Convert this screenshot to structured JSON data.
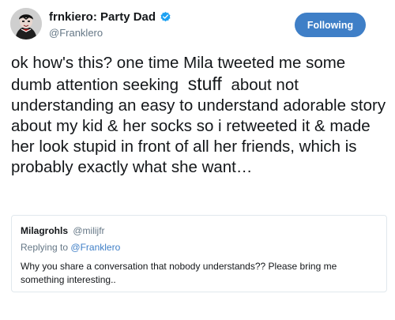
{
  "tweet": {
    "author": {
      "display_name": "frnkiero: Party Dad",
      "handle": "@Franklero",
      "verified": true
    },
    "follow_button_label": "Following",
    "text_before": "ok how's this? one time Mila tweeted me some dumb attention seeking",
    "text_emphasis": "stuff",
    "text_after": "about not understanding an easy to understand adorable story about my kid & her socks so i retweeted it & made her look stupid in front of all her friends, which is probably exactly what she want…",
    "quoted_tweet": {
      "display_name": "Milagrohls",
      "handle": "@milijfr",
      "replying_prefix": "Replying to",
      "replying_handle": "@Franklero",
      "text": "Why you share a conversation that nobody understands?? Please bring me something interesting.."
    }
  },
  "colors": {
    "accent": "#3f7fc7",
    "text_primary": "#14171a",
    "text_secondary": "#657786",
    "border": "#e1e8ed"
  },
  "icons": {
    "verified": "verified-badge-icon"
  }
}
